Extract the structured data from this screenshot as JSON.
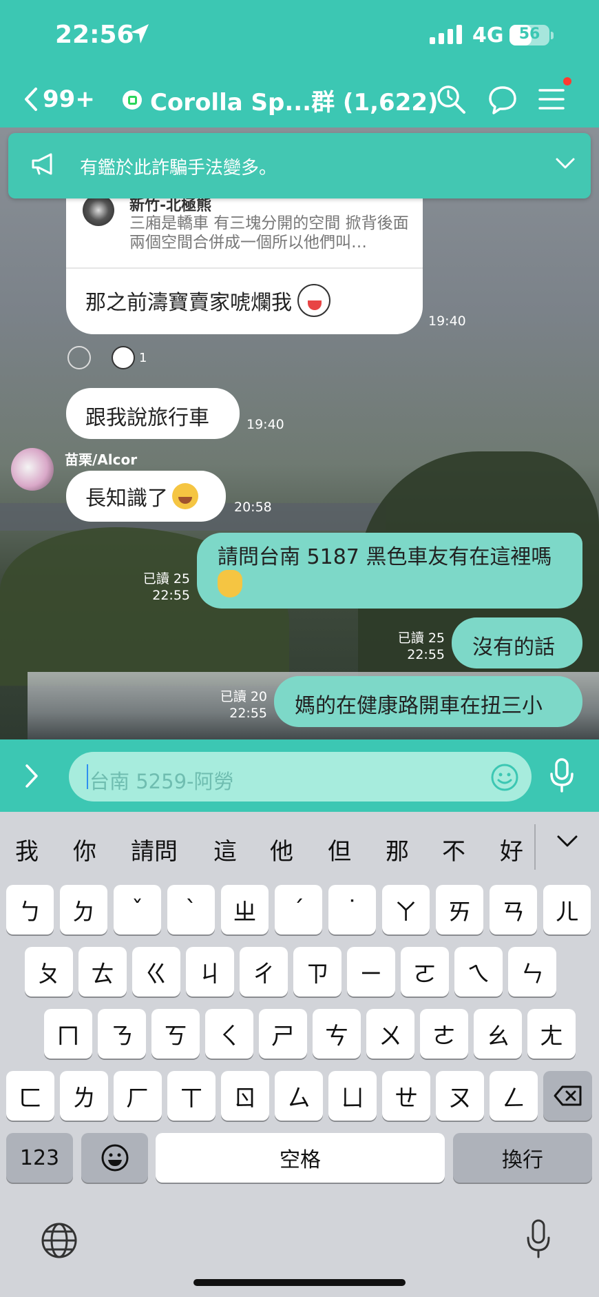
{
  "status": {
    "time": "22:56",
    "network": "4G",
    "battery": "56",
    "battery_level": 0.56
  },
  "nav": {
    "back_count": "99+",
    "title": "Corolla Sp...群 (1,622)"
  },
  "announcement": {
    "text": "有鑑於此詐騙手法變多。"
  },
  "messages": {
    "quote": {
      "author": "新竹-北極熊",
      "text": "三廂是轎車 有三塊分開的空間 掀背後面兩個空間合併成一個所以他們叫…",
      "reply": "那之前濤寶賣家唬爛我",
      "time": "19:40"
    },
    "reaction_count": "1",
    "msg2": {
      "text": "跟我說旅行車",
      "time": "19:40"
    },
    "msg3": {
      "sender": "苗栗/Alcor",
      "text": "長知識了",
      "time": "20:58"
    },
    "msg4": {
      "text": "請問台南 5187 黑色車友有在這裡嗎",
      "read": "已讀 25",
      "time": "22:55"
    },
    "msg5": {
      "text": "沒有的話",
      "read": "已讀 25",
      "time": "22:55"
    },
    "msg6": {
      "text": "媽的在健康路開車在扭三小",
      "read": "已讀 20",
      "time": "22:55"
    }
  },
  "input": {
    "placeholder": "台南 5259-阿勞"
  },
  "keyboard": {
    "suggestions": [
      "我",
      "你",
      "請問",
      "這",
      "他",
      "但",
      "那",
      "不",
      "好"
    ],
    "row1": [
      "ㄅ",
      "ㄉ",
      "ˇ",
      "ˋ",
      "ㄓ",
      "ˊ",
      "˙",
      "ㄚ",
      "ㄞ",
      "ㄢ",
      "ㄦ"
    ],
    "row2": [
      "ㄆ",
      "ㄊ",
      "ㄍ",
      "ㄐ",
      "ㄔ",
      "ㄗ",
      "ㄧ",
      "ㄛ",
      "ㄟ",
      "ㄣ"
    ],
    "row3": [
      "ㄇ",
      "ㄋ",
      "ㄎ",
      "ㄑ",
      "ㄕ",
      "ㄘ",
      "ㄨ",
      "ㄜ",
      "ㄠ",
      "ㄤ"
    ],
    "row4": [
      "ㄈ",
      "ㄌ",
      "ㄏ",
      "ㄒ",
      "ㄖ",
      "ㄙ",
      "ㄩ",
      "ㄝ",
      "ㄡ",
      "ㄥ"
    ],
    "numbers_key": "123",
    "space_key": "空格",
    "return_key": "換行"
  },
  "colors": {
    "brand": "#3cc7b3",
    "own_bubble": "#7dd8c8",
    "input_bg": "#a7ecdd"
  },
  "icons": {
    "location": "location-arrow-icon",
    "back": "chevron-left-icon",
    "search": "search-icon",
    "chat": "chat-bubbles-icon",
    "menu": "hamburger-menu-icon",
    "announce": "megaphone-icon",
    "expand": "chevron-down-icon",
    "input_expand": "chevron-right-icon",
    "emoji": "emoji-icon",
    "mic": "microphone-icon",
    "backspace": "backspace-icon",
    "globe": "globe-icon"
  }
}
